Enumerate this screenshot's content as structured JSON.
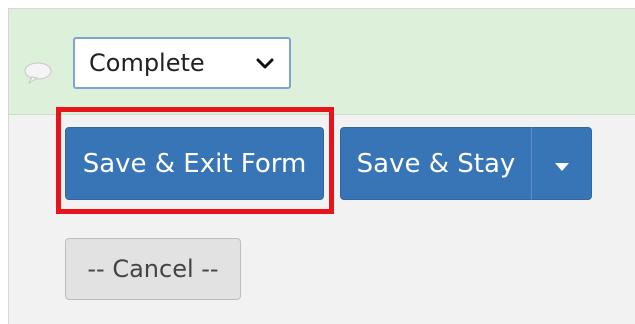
{
  "form_status": {
    "selected": "Complete"
  },
  "actions": {
    "save_exit_label": "Save & Exit Form",
    "save_stay_label": "Save & Stay",
    "cancel_label": "-- Cancel --"
  },
  "colors": {
    "status_row_bg": "#dcf0da",
    "primary_button": "#3875b7",
    "highlight_border": "#e8141b",
    "secondary_button": "#e2e2e2"
  },
  "icons": {
    "comment": "comment-bubble-icon",
    "select_arrow": "chevron-down-icon",
    "split_arrow": "caret-down-icon"
  }
}
